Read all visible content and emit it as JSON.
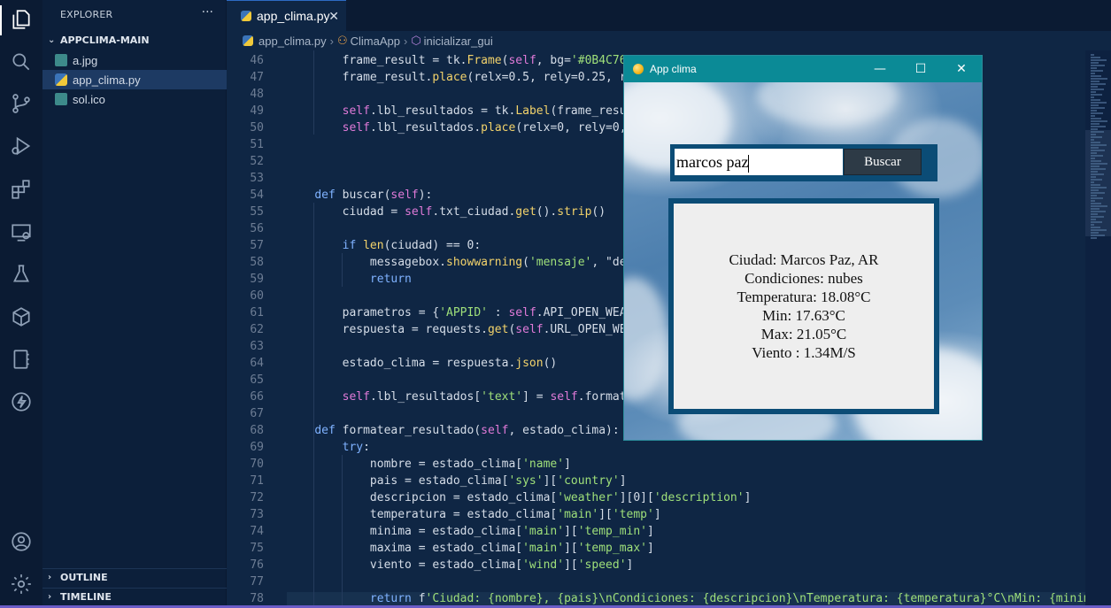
{
  "sidebar": {
    "title": "EXPLORER",
    "more": "···",
    "project": "APPCLIMA-MAIN",
    "files": [
      {
        "name": "a.jpg",
        "icon": "image-file-icon"
      },
      {
        "name": "app_clima.py",
        "icon": "python-file-icon"
      },
      {
        "name": "sol.ico",
        "icon": "image-file-icon"
      }
    ],
    "outline": "OUTLINE",
    "timeline": "TIMELINE"
  },
  "tab": {
    "label": "app_clima.py",
    "close": "✕"
  },
  "breadcrumb": {
    "file": "app_clima.py",
    "cls": "ClimaApp",
    "method": "inicializar_gui"
  },
  "code": {
    "lines": [
      {
        "n": "46",
        "t": "        frame_result = tk.Frame(self, bg='#0B4C76"
      },
      {
        "n": "47",
        "t": "        frame_result.place(relx=0.5, rely=0.25, re"
      },
      {
        "n": "48",
        "t": ""
      },
      {
        "n": "49",
        "t": "        self.lbl_resultados = tk.Label(frame_resul"
      },
      {
        "n": "50",
        "t": "        self.lbl_resultados.place(relx=0, rely=0,"
      },
      {
        "n": "51",
        "t": ""
      },
      {
        "n": "52",
        "t": ""
      },
      {
        "n": "53",
        "t": ""
      },
      {
        "n": "54",
        "t": "    def buscar(self):"
      },
      {
        "n": "55",
        "t": "        ciudad = self.txt_ciudad.get().strip()"
      },
      {
        "n": "56",
        "t": ""
      },
      {
        "n": "57",
        "t": "        if len(ciudad) == 0:"
      },
      {
        "n": "58",
        "t": "            messagebox.showwarning('mensaje', \"de"
      },
      {
        "n": "59",
        "t": "            return"
      },
      {
        "n": "60",
        "t": ""
      },
      {
        "n": "61",
        "t": "        parametros = {'APPID' : self.API_OPEN_WEA                                 'es'}"
      },
      {
        "n": "62",
        "t": "        respuesta = requests.get(self.URL_OPEN_WEA"
      },
      {
        "n": "63",
        "t": ""
      },
      {
        "n": "64",
        "t": "        estado_clima = respuesta.json()"
      },
      {
        "n": "65",
        "t": ""
      },
      {
        "n": "66",
        "t": "        self.lbl_resultados['text'] = self.formate"
      },
      {
        "n": "67",
        "t": ""
      },
      {
        "n": "68",
        "t": "    def formatear_resultado(self, estado_clima):"
      },
      {
        "n": "69",
        "t": "        try:"
      },
      {
        "n": "70",
        "t": "            nombre = estado_clima['name']"
      },
      {
        "n": "71",
        "t": "            pais = estado_clima['sys']['country']"
      },
      {
        "n": "72",
        "t": "            descripcion = estado_clima['weather'][0]['description']"
      },
      {
        "n": "73",
        "t": "            temperatura = estado_clima['main']['temp']"
      },
      {
        "n": "74",
        "t": "            minima = estado_clima['main']['temp_min']"
      },
      {
        "n": "75",
        "t": "            maxima = estado_clima['main']['temp_max']"
      },
      {
        "n": "76",
        "t": "            viento = estado_clima['wind']['speed']"
      },
      {
        "n": "77",
        "t": ""
      },
      {
        "n": "78",
        "t": "            return f'Ciudad: {nombre}, {pais}\\nCondiciones: {descripcion}\\nTemperatura: {temperatura}°C\\nMin: {minima"
      }
    ]
  },
  "app": {
    "title": "App clima",
    "minimize": "—",
    "maximize": "☐",
    "close": "✕",
    "search_value": "marcos paz",
    "search_button": "Buscar",
    "results": [
      "Ciudad: Marcos Paz, AR",
      "Condiciones: nubes",
      "Temperatura: 18.08°C",
      "Min: 17.63°C",
      "Max: 21.05°C",
      "Viento : 1.34M/S"
    ]
  }
}
